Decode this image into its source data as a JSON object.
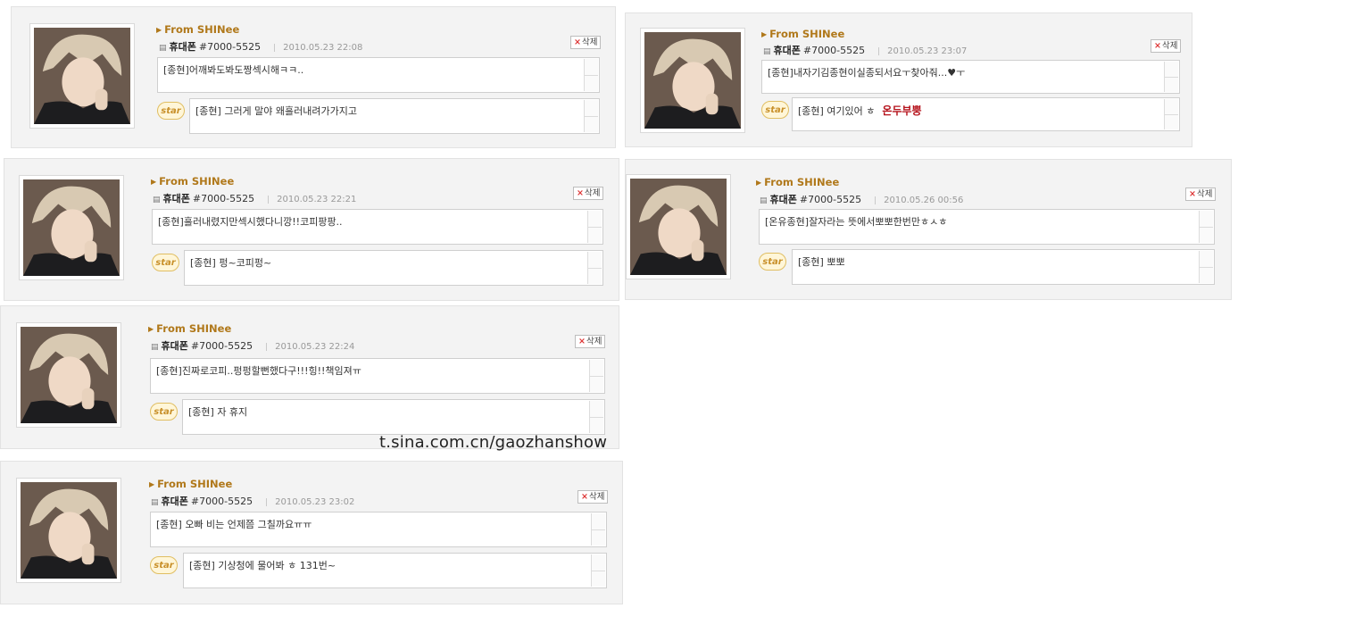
{
  "from_label": "From SHINee",
  "sender": "휴대폰",
  "number": "#7000-5525",
  "delete_label": "삭제",
  "star_label": "star",
  "watermark": "t.sina.com.cn/gaozhanshow",
  "cards": [
    {
      "date": "2010.05.23 22:08",
      "message": "[종현]어깨봐도봐도짱섹시해ㅋㅋ..",
      "reply": "[종현] 그러게 말야 왜흘러내려가가지고",
      "reply_extra": ""
    },
    {
      "date": "2010.05.23 23:07",
      "message": "[종현]내자기김종현이실종되서요ㅜ찾아줘...♥ㅜ",
      "reply": "[종현] 여기있어 ㅎ",
      "reply_extra": "온두부뿡"
    },
    {
      "date": "2010.05.23 22:21",
      "message": "[종현]흘러내렸지만섹시했다니깡!!코피팡팡..",
      "reply": "[종현] 펑~코피펑~",
      "reply_extra": ""
    },
    {
      "date": "2010.05.26 00:56",
      "message": "[온유종현]잘자라는 뜻에서뽀뽀한번만ㅎㅅㅎ",
      "reply": "[종현] 뽀뽀",
      "reply_extra": ""
    },
    {
      "date": "2010.05.23 22:24",
      "message": "[종현]진짜로코피..펑펑할뻔했다구!!!힝!!책임져ㅠ",
      "reply": "[종현] 자 휴지",
      "reply_extra": ""
    },
    {
      "date": "2010.05.23 23:02",
      "message": "[종현] 오빠 비는 언제쯤 그칠까요ㅠㅠ",
      "reply": "[종현] 기상청에 물어봐 ㅎ 131번~",
      "reply_extra": ""
    }
  ]
}
